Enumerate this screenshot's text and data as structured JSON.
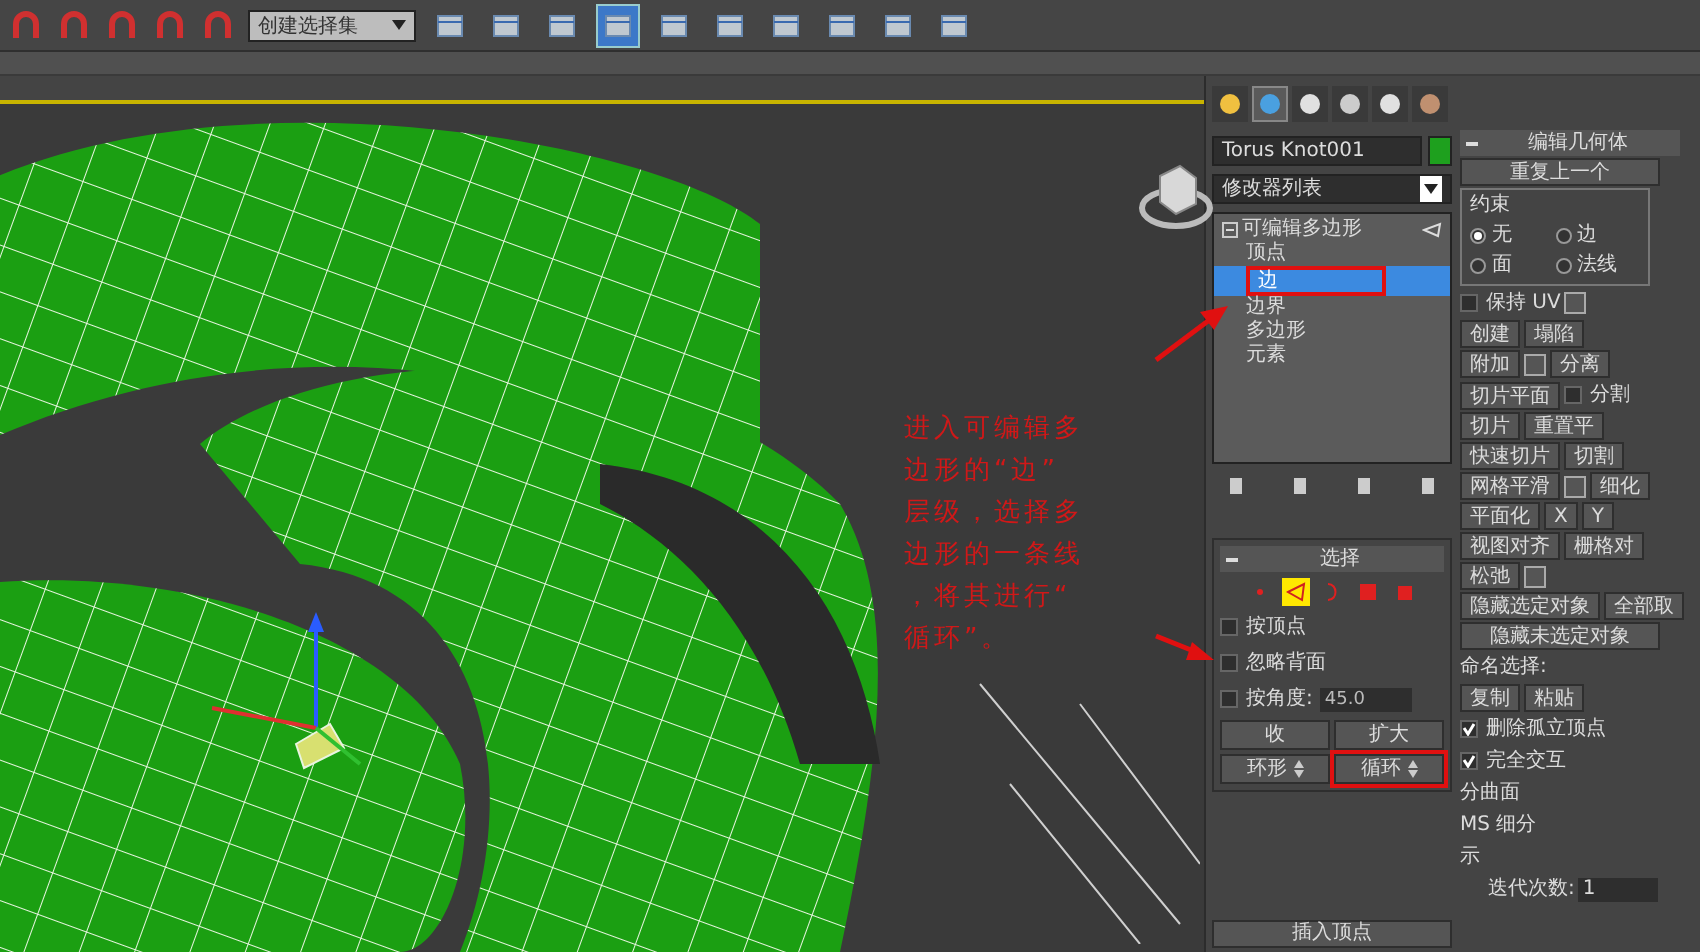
{
  "toolbar": {
    "selection_set": {
      "value": "创建选择集"
    }
  },
  "annotation": {
    "lines": [
      "进入可编辑多",
      "边形的“边”",
      "层级，选择多",
      "边形的一条线",
      "，将其进行“",
      "循环”。"
    ]
  },
  "command_panel": {
    "tabs": [
      {
        "kind": "create",
        "selected": false
      },
      {
        "kind": "modify",
        "selected": true
      },
      {
        "kind": "hierarchy",
        "selected": false
      },
      {
        "kind": "motion",
        "selected": false
      },
      {
        "kind": "display",
        "selected": false
      },
      {
        "kind": "utilities",
        "selected": false
      }
    ],
    "object_name": "Torus Knot001",
    "modifier_list": "修改器列表",
    "stack": [
      {
        "label": "可编辑多边形",
        "expanded": true,
        "children": [
          {
            "label": "顶点",
            "selected": false
          },
          {
            "label": "边",
            "selected": true
          },
          {
            "label": "边界",
            "selected": false
          },
          {
            "label": "多边形",
            "selected": false
          },
          {
            "label": "元素",
            "selected": false
          }
        ]
      }
    ],
    "selection": {
      "title": "选择",
      "levels": [
        {
          "kind": "vertex",
          "selected": false
        },
        {
          "kind": "edge",
          "selected": true
        },
        {
          "kind": "border",
          "selected": false
        },
        {
          "kind": "polygon",
          "selected": false
        },
        {
          "kind": "element",
          "selected": false
        }
      ],
      "checkboxes": [
        {
          "label": "按顶点",
          "checked": false
        },
        {
          "label": "忽略背面",
          "checked": false
        },
        {
          "label": "按角度:",
          "checked": false
        }
      ],
      "angle": "45.0",
      "buttons": [
        {
          "label": "收",
          "kind": "button"
        },
        {
          "label": "扩大",
          "kind": "button"
        },
        {
          "label": "环形",
          "kind": "spinner"
        },
        {
          "label": "循环",
          "kind": "spinner"
        }
      ]
    },
    "insert_vertex": "插入顶点",
    "edit_geometry": {
      "title": "编辑几何体",
      "rows": [
        [
          {
            "kind": "button",
            "label": "重复上一个"
          }
        ],
        [
          {
            "kind": "group",
            "label": "约束",
            "radios": [
              {
                "label": "无",
                "selected": true
              },
              {
                "label": "边",
                "selected": false
              },
              {
                "label": "面",
                "selected": false
              },
              {
                "label": "法线",
                "selected": false
              }
            ]
          }
        ],
        [
          {
            "kind": "checkbox",
            "label": "保持 UV",
            "checked": false
          },
          {
            "kind": "settings"
          }
        ],
        [
          {
            "kind": "button",
            "label": "创建"
          },
          {
            "kind": "button",
            "label": "塌陷"
          }
        ],
        [
          {
            "kind": "button",
            "label": "附加"
          },
          {
            "kind": "settings"
          },
          {
            "kind": "button",
            "label": "分离"
          }
        ],
        [
          {
            "kind": "button",
            "label": "切片平面"
          },
          {
            "kind": "checkbox",
            "label": "分割",
            "checked": false
          }
        ],
        [
          {
            "kind": "button",
            "label": "切片"
          },
          {
            "kind": "button",
            "label": "重置平"
          }
        ],
        [
          {
            "kind": "button",
            "label": "快速切片"
          },
          {
            "kind": "button",
            "label": "切割"
          }
        ],
        [
          {
            "kind": "button",
            "label": "网格平滑"
          },
          {
            "kind": "settings"
          },
          {
            "kind": "button",
            "label": "细化"
          }
        ],
        [
          {
            "kind": "button",
            "label": "平面化"
          },
          {
            "kind": "button",
            "label": "X"
          },
          {
            "kind": "button",
            "label": "Y"
          }
        ],
        [
          {
            "kind": "button",
            "label": "视图对齐"
          },
          {
            "kind": "button",
            "label": "栅格对"
          }
        ],
        [
          {
            "kind": "button",
            "label": "松弛"
          },
          {
            "kind": "settings"
          }
        ],
        [
          {
            "kind": "button",
            "label": "隐藏选定对象"
          },
          {
            "kind": "button",
            "label": "全部取"
          }
        ],
        [
          {
            "kind": "button",
            "label": "隐藏未选定对象"
          }
        ],
        [
          {
            "kind": "label",
            "label": "命名选择:"
          }
        ],
        [
          {
            "kind": "button",
            "label": "复制"
          },
          {
            "kind": "button",
            "label": "粘贴"
          }
        ],
        [
          {
            "kind": "checkbox",
            "label": "删除孤立顶点",
            "checked": true
          }
        ],
        [
          {
            "kind": "checkbox",
            "label": "完全交互",
            "checked": true
          }
        ],
        [
          {
            "kind": "label",
            "label": "分曲面"
          }
        ],
        [
          {
            "kind": "label",
            "label": "MS 细分"
          }
        ],
        [
          {
            "kind": "label",
            "label": "示"
          }
        ],
        [
          {
            "kind": "spinner",
            "label": "迭代次数:",
            "value": "1"
          }
        ]
      ]
    }
  }
}
